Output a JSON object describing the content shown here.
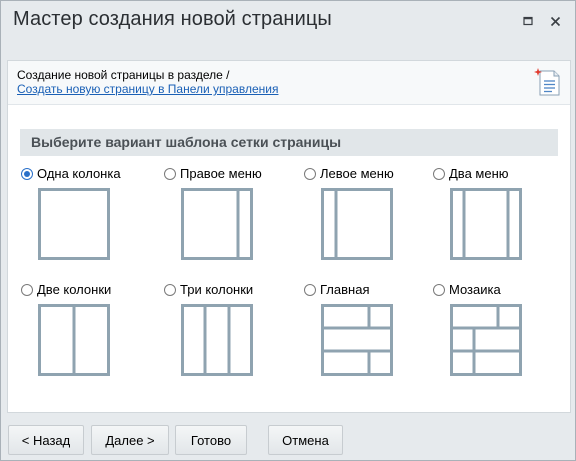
{
  "window": {
    "title": "Мастер создания новой страницы",
    "restore_icon": "restore-icon",
    "close_icon": "close-icon"
  },
  "intro": {
    "text": "Создание новой страницы в разделе /",
    "link": "Создать новую страницу в Панели управления",
    "icon": "new-document-icon"
  },
  "section_title": "Выберите вариант шаблона сетки страницы",
  "options": [
    {
      "label": "Одна колонка",
      "selected": true
    },
    {
      "label": "Правое меню",
      "selected": false
    },
    {
      "label": "Левое меню",
      "selected": false
    },
    {
      "label": "Два меню",
      "selected": false
    },
    {
      "label": "Две колонки",
      "selected": false
    },
    {
      "label": "Три колонки",
      "selected": false
    },
    {
      "label": "Главная",
      "selected": false
    },
    {
      "label": "Мозаика",
      "selected": false
    }
  ],
  "buttons": {
    "back": "< Назад",
    "next": "Далее >",
    "done": "Готово",
    "cancel": "Отмена"
  },
  "colors": {
    "thumb_stroke": "#8fa3b0",
    "radio_accent": "#2a70c9",
    "link": "#1a60b6"
  }
}
